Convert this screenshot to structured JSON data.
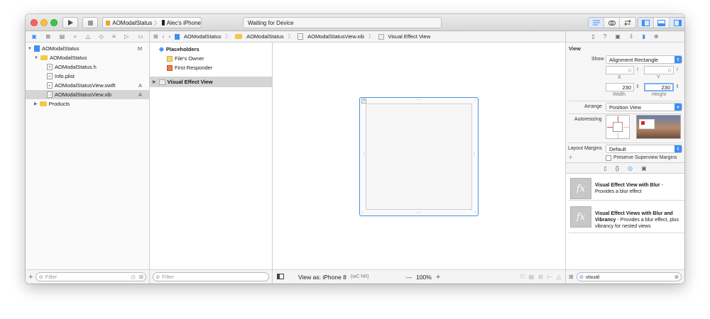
{
  "toolbar": {
    "scheme_target": "AOModalStatus",
    "scheme_device": "Alec's iPhone",
    "status_text": "Waiting for Device"
  },
  "navigator": {
    "project": {
      "label": "AOModalStatus",
      "status": "M"
    },
    "group": {
      "label": "AOModalStatus"
    },
    "files": [
      {
        "label": "AOModalStatus.h",
        "status": ""
      },
      {
        "label": "Info.plist",
        "status": ""
      },
      {
        "label": "AOModalStatusView.swift",
        "status": "A"
      },
      {
        "label": "AOModalStatusView.xib",
        "status": "A"
      }
    ],
    "products": {
      "label": "Products"
    },
    "filter_placeholder": "Filter"
  },
  "jumpbar": {
    "crumbs": [
      "AOModalStatus",
      "AOModalStatus",
      "AOModalStatusView.xib",
      "Visual Effect View"
    ]
  },
  "outline": {
    "placeholders_label": "Placeholders",
    "files_owner": "File's Owner",
    "first_responder": "First Responder",
    "visual_effect_view": "Visual Effect View",
    "filter_placeholder": "Filter"
  },
  "canvas": {
    "view_as": "View as: iPhone 8",
    "traits": "(wC hR)",
    "zoom_minus": "—",
    "zoom": "100%",
    "zoom_plus": "+"
  },
  "inspector": {
    "section_title": "View",
    "show_label": "Show",
    "show_value": "Alignment Rectangle",
    "x_value": "0",
    "y_value": "0",
    "x_label": "X",
    "y_label": "Y",
    "width_value": "230",
    "height_value": "230",
    "width_label": "Width",
    "height_label": "Height",
    "arrange_label": "Arrange",
    "arrange_value": "Position View",
    "autoresizing_label": "Autoresizing",
    "layout_margins_label": "Layout Margins",
    "layout_margins_value": "Default",
    "preserve_label": "Preserve Superview Margins",
    "plus": "+"
  },
  "library": {
    "items": [
      {
        "title": "Visual Effect View with Blur",
        "desc": " - Provides a blur effect"
      },
      {
        "title": "Visual Effect Views with Blur and Vibrancy",
        "desc": " - Provides a blur effect, plus vibrancy for nested views"
      }
    ],
    "search_value": "visual"
  },
  "colors": {
    "accent": "#3d8ff6",
    "selection": "#d5d5d5",
    "view_border": "#4a90d9"
  }
}
